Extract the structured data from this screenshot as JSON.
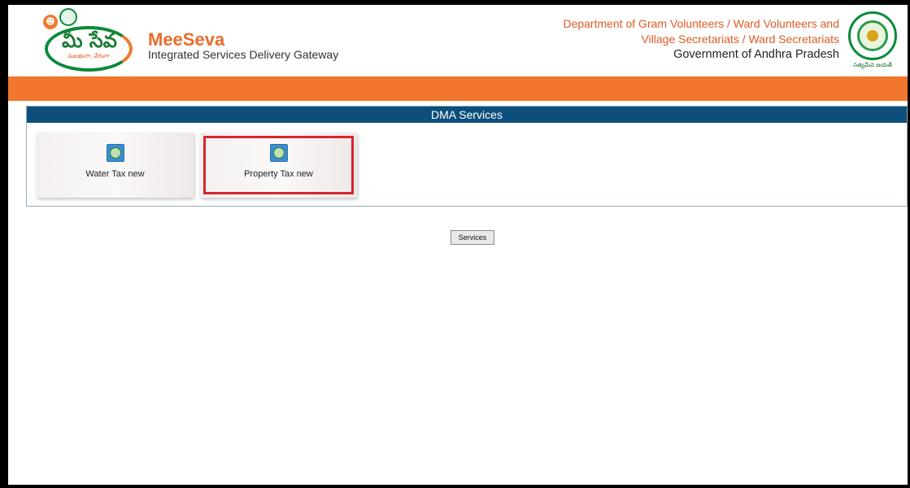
{
  "header": {
    "logo_text": "మీ సేవ",
    "logo_subtext": "సులభంగా, వేగంగా",
    "brand_title": "MeeSeva",
    "brand_subtitle": "Integrated Services Delivery Gateway",
    "dept_line1": "Department of Gram Volunteers / Ward Volunteers and",
    "dept_line2": "Village Secretariats / Ward Secretariats",
    "dept_line3": "Government of Andhra Pradesh",
    "emblem_caption": "సత్యమేవ జయతే"
  },
  "panel": {
    "title": "DMA Services",
    "tiles": [
      {
        "label": "Water Tax new",
        "icon": "service-icon",
        "selected": false
      },
      {
        "label": "Property Tax new",
        "icon": "service-icon",
        "selected": true
      }
    ]
  },
  "actions": {
    "services_label": "Services"
  },
  "colors": {
    "brand_orange": "#f0772d",
    "panel_header": "#0d4f7c",
    "highlight": "#d6262b",
    "logo_green": "#0a8a3a"
  }
}
